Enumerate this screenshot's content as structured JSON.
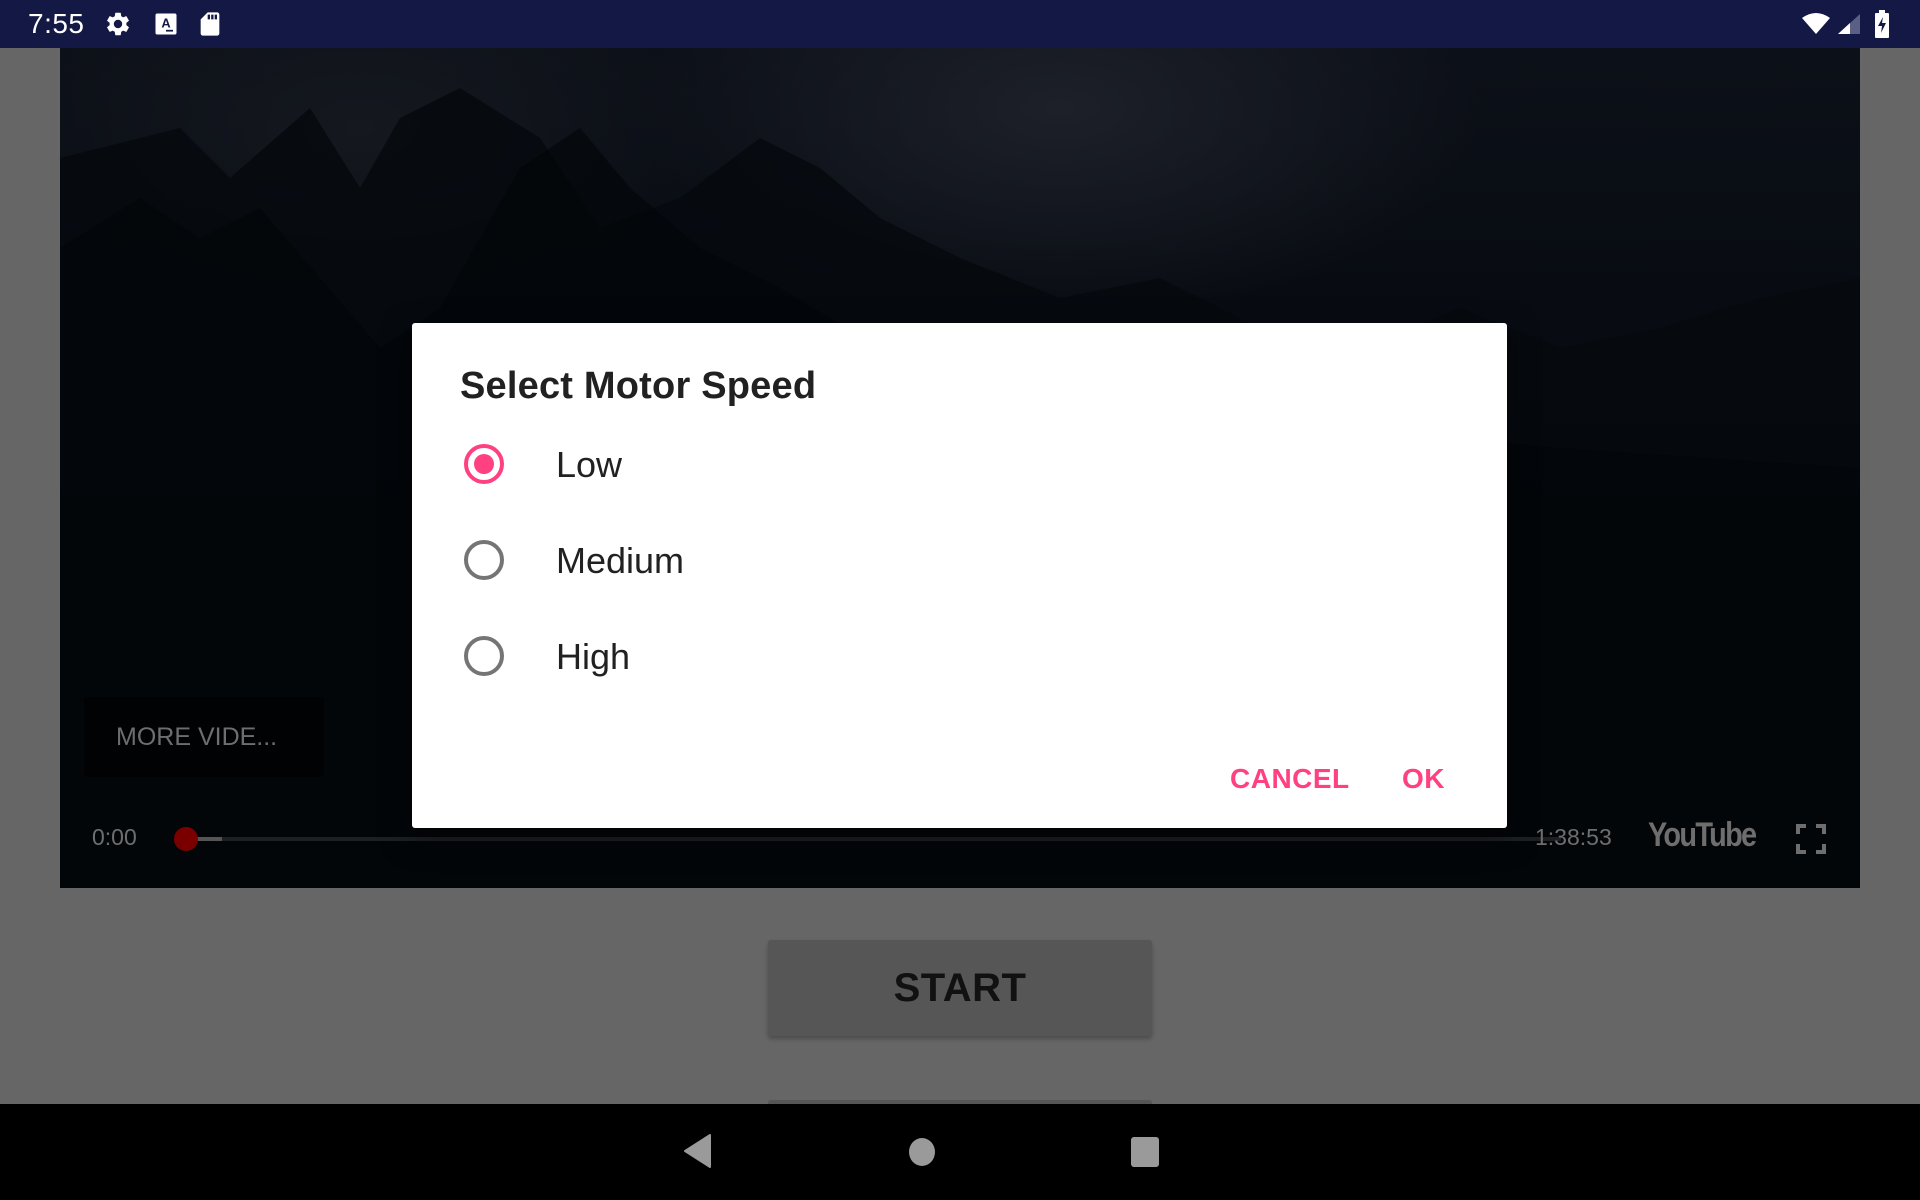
{
  "status_bar": {
    "time": "7:55",
    "left_icons": [
      "gear-icon",
      "keyboard-a-icon",
      "sd-card-icon"
    ],
    "right_icons": [
      "wifi-icon",
      "cell-signal-icon",
      "battery-charging-icon"
    ],
    "background_color": "#131944"
  },
  "video_player": {
    "more_videos_label": "MORE VIDE...",
    "current_time": "0:00",
    "total_time": "1:38:53",
    "progress_fraction": 0.0,
    "logo_text": "YouTube",
    "fullscreen_icon": "fullscreen-icon"
  },
  "page": {
    "start_button_label": "START"
  },
  "dialog": {
    "title": "Select Motor Speed",
    "options": [
      {
        "label": "Low",
        "checked": true
      },
      {
        "label": "Medium",
        "checked": false
      },
      {
        "label": "High",
        "checked": false
      }
    ],
    "cancel_label": "CANCEL",
    "ok_label": "OK",
    "accent_color": "#FF4081"
  },
  "nav_bar": {
    "buttons": [
      "back-icon",
      "home-icon",
      "recents-icon"
    ]
  }
}
